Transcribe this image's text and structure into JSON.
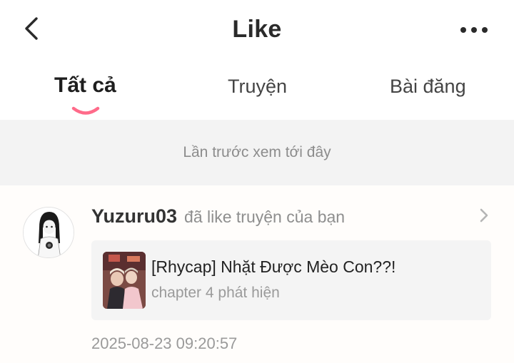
{
  "header": {
    "title": "Like",
    "back_icon": "chevron-left-icon",
    "more_icon": "more-horizontal-icon"
  },
  "tabs": [
    {
      "label": "Tất cả",
      "active": true
    },
    {
      "label": "Truyện",
      "active": false
    },
    {
      "label": "Bài đăng",
      "active": false
    }
  ],
  "accent_color": "#ff6b8a",
  "last_seen_text": "Lần trước xem tới đây",
  "notification": {
    "username": "Yuzuru03",
    "action": "đã like truyện của bạn",
    "story": {
      "title": "[Rhycap] Nhặt Được Mèo Con??!",
      "subtitle": "chapter 4 phát hiện"
    },
    "timestamp": "2025-08-23 09:20:57"
  }
}
